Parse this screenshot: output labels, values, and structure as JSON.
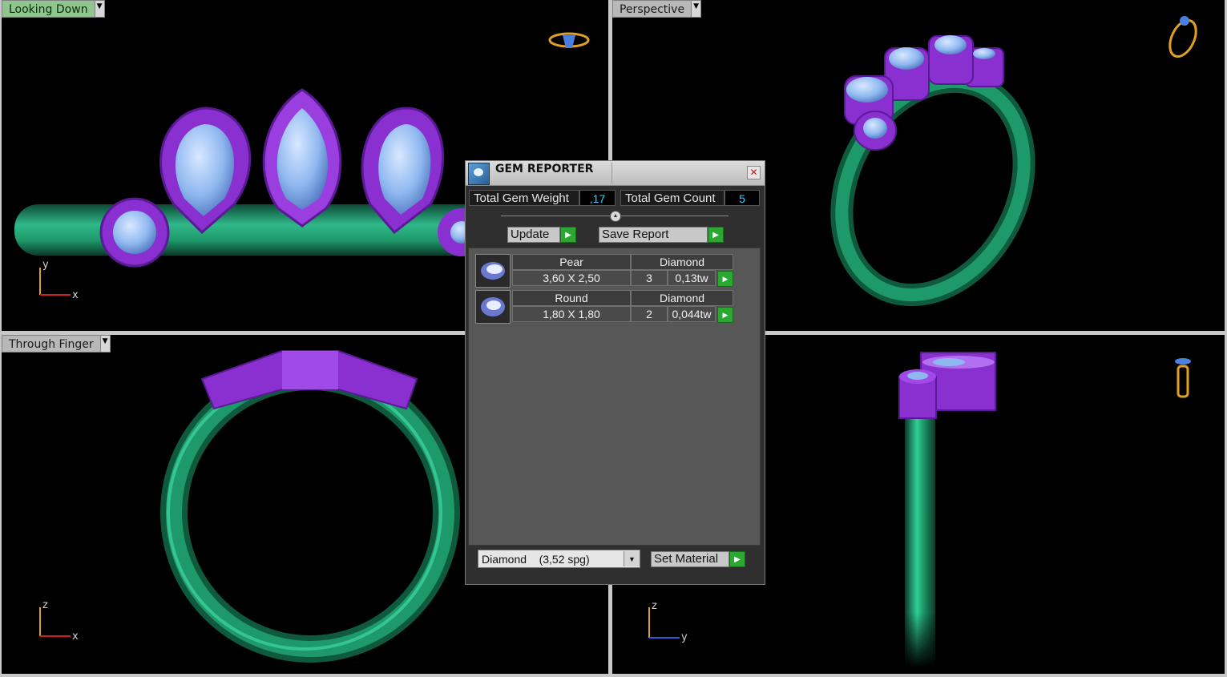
{
  "viewports": [
    {
      "label": "Looking Down",
      "axes": [
        "y",
        "x"
      ]
    },
    {
      "label": "Perspective",
      "axes": []
    },
    {
      "label": "Through Finger",
      "axes": [
        "z",
        "x"
      ]
    },
    {
      "label": "",
      "axes": [
        "z",
        "y"
      ]
    }
  ],
  "gem_reporter": {
    "title": "GEM REPORTER",
    "close_glyph": "✕",
    "total_weight_label": "Total Gem Weight",
    "total_weight_value": ",17",
    "total_count_label": "Total Gem Count",
    "total_count_value": "5",
    "update_label": "Update",
    "save_report_label": "Save Report",
    "gems": [
      {
        "shape": "Pear",
        "size": "3,60 X 2,50",
        "material": "Diamond",
        "count": "3",
        "weight": "0,13tw"
      },
      {
        "shape": "Round",
        "size": "1,80 X 1,80",
        "material": "Diamond",
        "count": "2",
        "weight": "0,044tw"
      }
    ],
    "material_select": "Diamond    (3,52 spg)",
    "set_material_label": "Set Material"
  },
  "colors": {
    "metal": "#1e9a6a",
    "bezel": "#8a2fd0",
    "gem": "#8fb8f0",
    "active_label": "#8fc68f",
    "nav_icon": "#e0a020"
  },
  "icons": {
    "dropdown": "chevron-down-icon",
    "play": "play-arrow-icon",
    "close": "close-icon"
  }
}
